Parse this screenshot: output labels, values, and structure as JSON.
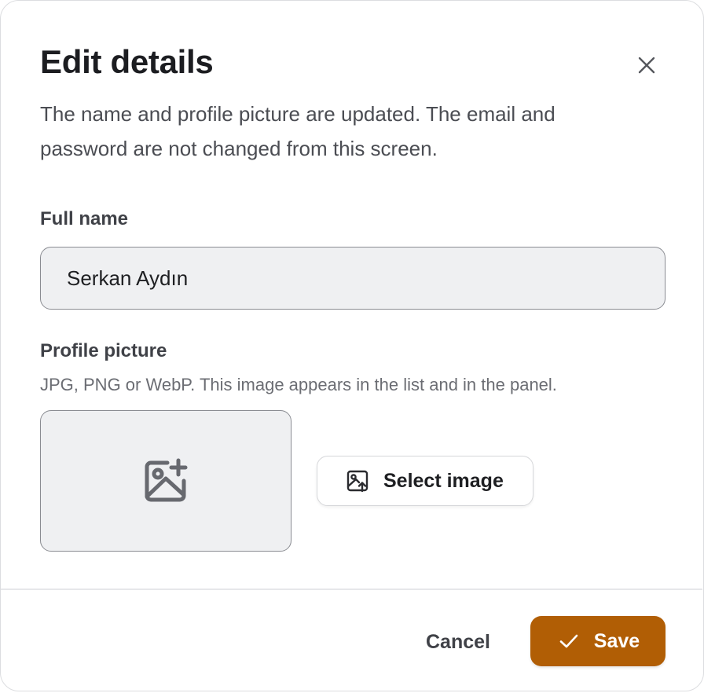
{
  "dialog": {
    "title": "Edit details",
    "description": "The name and profile picture are updated. The email and password are not changed from this screen.",
    "close_icon": "close-icon"
  },
  "full_name": {
    "label": "Full name",
    "value": "Serkan Aydın"
  },
  "profile_picture": {
    "label": "Profile picture",
    "hint": "JPG, PNG or WebP. This image appears in the list and in the panel.",
    "placeholder_icon": "image-plus-icon",
    "select_button": {
      "label": "Select image",
      "icon": "image-upload-icon"
    }
  },
  "footer": {
    "cancel_label": "Cancel",
    "save_label": "Save",
    "save_icon": "check-icon"
  },
  "colors": {
    "accent": "#b15e05",
    "input_background": "#eff0f2",
    "border": "#8a8c92",
    "text": "#1e1f22",
    "muted_text": "#6b6d73"
  }
}
